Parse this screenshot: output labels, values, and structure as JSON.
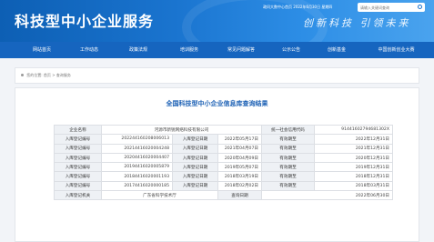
{
  "header": {
    "site_title": "科技型中小企业服务",
    "top_links": "政问大数中心首页  2022年6月30日 星期四",
    "search_placeholder": "请输入关键词查询",
    "slogan": "创新科技 引领未来"
  },
  "nav": [
    "网站首页",
    "工作动态",
    "政策法规",
    "培训服务",
    "常见问题解答",
    "公示公告",
    "创新基金",
    "中国创新创业大赛"
  ],
  "breadcrumb": {
    "prefix": "您的位置:",
    "home": "首页",
    "sep": ">",
    "current": "查询服务"
  },
  "page_title": "全国科技型中小企业信息库查询结果",
  "info": {
    "company_label": "企业名称",
    "company_value": "河源市新锐网络科技有限公司",
    "credit_label": "统一社会信用代码",
    "credit_value": "91441602794681302X",
    "records": [
      {
        "reg_label": "入库登记编号",
        "reg_no": "20224416020800601​3",
        "date_label": "入库登记日期",
        "date": "2022年05月17日",
        "valid_label": "有效期至",
        "valid": "2022年12月31日"
      },
      {
        "reg_label": "入库登记编号",
        "reg_no": "20214416020004248",
        "date_label": "入库登记日期",
        "date": "2021年04月07日",
        "valid_label": "有效期至",
        "valid": "2021年12月31日"
      },
      {
        "reg_label": "入库登记编号",
        "reg_no": "20204416020004407",
        "date_label": "入库登记日期",
        "date": "2020年04月09日",
        "valid_label": "有效期至",
        "valid": "2020年12月31日"
      },
      {
        "reg_label": "入库登记编号",
        "reg_no": "20194416020005879",
        "date_label": "入库登记日期",
        "date": "2019年05月07日",
        "valid_label": "有效期至",
        "valid": "2019年12月31日"
      },
      {
        "reg_label": "入库登记编号",
        "reg_no": "20184416020001193",
        "date_label": "入库登记日期",
        "date": "2018年03月19日",
        "valid_label": "有效期至",
        "valid": "2018年12月31日"
      },
      {
        "reg_label": "入库登记编号",
        "reg_no": "20174416020000185",
        "date_label": "入库登记日期",
        "date": "2018年02月02日",
        "valid_label": "有效期至",
        "valid": "2018年03月31日"
      }
    ],
    "authority_label": "入库登记机关",
    "authority_value": "广东省科学技术厅",
    "query_time_label": "查询日期",
    "query_time_value": "2022年06月30日"
  }
}
